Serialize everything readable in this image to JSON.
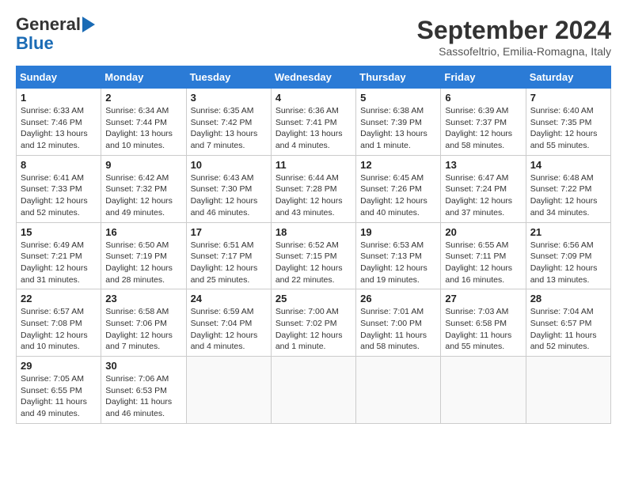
{
  "header": {
    "logo_general": "General",
    "logo_blue": "Blue",
    "month_title": "September 2024",
    "subtitle": "Sassofeltrio, Emilia-Romagna, Italy"
  },
  "days_of_week": [
    "Sunday",
    "Monday",
    "Tuesday",
    "Wednesday",
    "Thursday",
    "Friday",
    "Saturday"
  ],
  "weeks": [
    [
      {
        "day": "1",
        "info": "Sunrise: 6:33 AM\nSunset: 7:46 PM\nDaylight: 13 hours\nand 12 minutes."
      },
      {
        "day": "2",
        "info": "Sunrise: 6:34 AM\nSunset: 7:44 PM\nDaylight: 13 hours\nand 10 minutes."
      },
      {
        "day": "3",
        "info": "Sunrise: 6:35 AM\nSunset: 7:42 PM\nDaylight: 13 hours\nand 7 minutes."
      },
      {
        "day": "4",
        "info": "Sunrise: 6:36 AM\nSunset: 7:41 PM\nDaylight: 13 hours\nand 4 minutes."
      },
      {
        "day": "5",
        "info": "Sunrise: 6:38 AM\nSunset: 7:39 PM\nDaylight: 13 hours\nand 1 minute."
      },
      {
        "day": "6",
        "info": "Sunrise: 6:39 AM\nSunset: 7:37 PM\nDaylight: 12 hours\nand 58 minutes."
      },
      {
        "day": "7",
        "info": "Sunrise: 6:40 AM\nSunset: 7:35 PM\nDaylight: 12 hours\nand 55 minutes."
      }
    ],
    [
      {
        "day": "8",
        "info": "Sunrise: 6:41 AM\nSunset: 7:33 PM\nDaylight: 12 hours\nand 52 minutes."
      },
      {
        "day": "9",
        "info": "Sunrise: 6:42 AM\nSunset: 7:32 PM\nDaylight: 12 hours\nand 49 minutes."
      },
      {
        "day": "10",
        "info": "Sunrise: 6:43 AM\nSunset: 7:30 PM\nDaylight: 12 hours\nand 46 minutes."
      },
      {
        "day": "11",
        "info": "Sunrise: 6:44 AM\nSunset: 7:28 PM\nDaylight: 12 hours\nand 43 minutes."
      },
      {
        "day": "12",
        "info": "Sunrise: 6:45 AM\nSunset: 7:26 PM\nDaylight: 12 hours\nand 40 minutes."
      },
      {
        "day": "13",
        "info": "Sunrise: 6:47 AM\nSunset: 7:24 PM\nDaylight: 12 hours\nand 37 minutes."
      },
      {
        "day": "14",
        "info": "Sunrise: 6:48 AM\nSunset: 7:22 PM\nDaylight: 12 hours\nand 34 minutes."
      }
    ],
    [
      {
        "day": "15",
        "info": "Sunrise: 6:49 AM\nSunset: 7:21 PM\nDaylight: 12 hours\nand 31 minutes."
      },
      {
        "day": "16",
        "info": "Sunrise: 6:50 AM\nSunset: 7:19 PM\nDaylight: 12 hours\nand 28 minutes."
      },
      {
        "day": "17",
        "info": "Sunrise: 6:51 AM\nSunset: 7:17 PM\nDaylight: 12 hours\nand 25 minutes."
      },
      {
        "day": "18",
        "info": "Sunrise: 6:52 AM\nSunset: 7:15 PM\nDaylight: 12 hours\nand 22 minutes."
      },
      {
        "day": "19",
        "info": "Sunrise: 6:53 AM\nSunset: 7:13 PM\nDaylight: 12 hours\nand 19 minutes."
      },
      {
        "day": "20",
        "info": "Sunrise: 6:55 AM\nSunset: 7:11 PM\nDaylight: 12 hours\nand 16 minutes."
      },
      {
        "day": "21",
        "info": "Sunrise: 6:56 AM\nSunset: 7:09 PM\nDaylight: 12 hours\nand 13 minutes."
      }
    ],
    [
      {
        "day": "22",
        "info": "Sunrise: 6:57 AM\nSunset: 7:08 PM\nDaylight: 12 hours\nand 10 minutes."
      },
      {
        "day": "23",
        "info": "Sunrise: 6:58 AM\nSunset: 7:06 PM\nDaylight: 12 hours\nand 7 minutes."
      },
      {
        "day": "24",
        "info": "Sunrise: 6:59 AM\nSunset: 7:04 PM\nDaylight: 12 hours\nand 4 minutes."
      },
      {
        "day": "25",
        "info": "Sunrise: 7:00 AM\nSunset: 7:02 PM\nDaylight: 12 hours\nand 1 minute."
      },
      {
        "day": "26",
        "info": "Sunrise: 7:01 AM\nSunset: 7:00 PM\nDaylight: 11 hours\nand 58 minutes."
      },
      {
        "day": "27",
        "info": "Sunrise: 7:03 AM\nSunset: 6:58 PM\nDaylight: 11 hours\nand 55 minutes."
      },
      {
        "day": "28",
        "info": "Sunrise: 7:04 AM\nSunset: 6:57 PM\nDaylight: 11 hours\nand 52 minutes."
      }
    ],
    [
      {
        "day": "29",
        "info": "Sunrise: 7:05 AM\nSunset: 6:55 PM\nDaylight: 11 hours\nand 49 minutes."
      },
      {
        "day": "30",
        "info": "Sunrise: 7:06 AM\nSunset: 6:53 PM\nDaylight: 11 hours\nand 46 minutes."
      },
      {
        "day": "",
        "info": ""
      },
      {
        "day": "",
        "info": ""
      },
      {
        "day": "",
        "info": ""
      },
      {
        "day": "",
        "info": ""
      },
      {
        "day": "",
        "info": ""
      }
    ]
  ]
}
